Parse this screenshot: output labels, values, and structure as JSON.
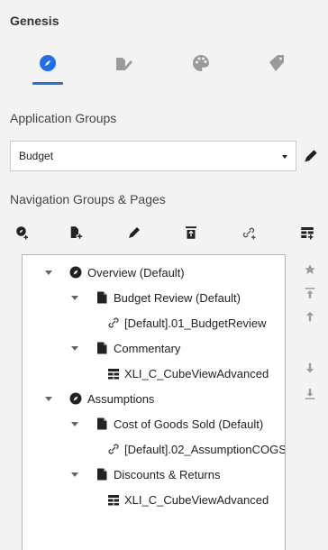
{
  "app": {
    "title": "Genesis"
  },
  "tabs": [
    {
      "name": "compass",
      "active": true
    },
    {
      "name": "pages-edit",
      "active": false
    },
    {
      "name": "palette",
      "active": false
    },
    {
      "name": "tag",
      "active": false
    }
  ],
  "application_groups": {
    "label": "Application Groups",
    "selected": "Budget"
  },
  "navigation": {
    "label": "Navigation Groups & Pages",
    "toolbar": [
      "add-group-icon",
      "add-page-icon",
      "edit-icon",
      "delete-icon",
      "add-link-icon",
      "add-cube-view-icon"
    ]
  },
  "tree": [
    {
      "level": 0,
      "type": "group",
      "label": "Overview (Default)"
    },
    {
      "level": 1,
      "type": "page",
      "label": "Budget Review (Default)"
    },
    {
      "level": 2,
      "type": "link",
      "label": "[Default].01_BudgetReview"
    },
    {
      "level": 1,
      "type": "page",
      "label": "Commentary"
    },
    {
      "level": 2,
      "type": "cube",
      "label": "XLI_C_CubeViewAdvanced"
    },
    {
      "level": 0,
      "type": "group",
      "label": "Assumptions"
    },
    {
      "level": 1,
      "type": "page",
      "label": "Cost of Goods Sold (Default)"
    },
    {
      "level": 2,
      "type": "link",
      "label": "[Default].02_AssumptionCOGS"
    },
    {
      "level": 1,
      "type": "page",
      "label": "Discounts & Returns"
    },
    {
      "level": 2,
      "type": "cube",
      "label": "XLI_C_CubeViewAdvanced"
    }
  ],
  "colors": {
    "accent": "#1e6ff0",
    "icon": "#222222",
    "muted": "#9a9a9a"
  }
}
